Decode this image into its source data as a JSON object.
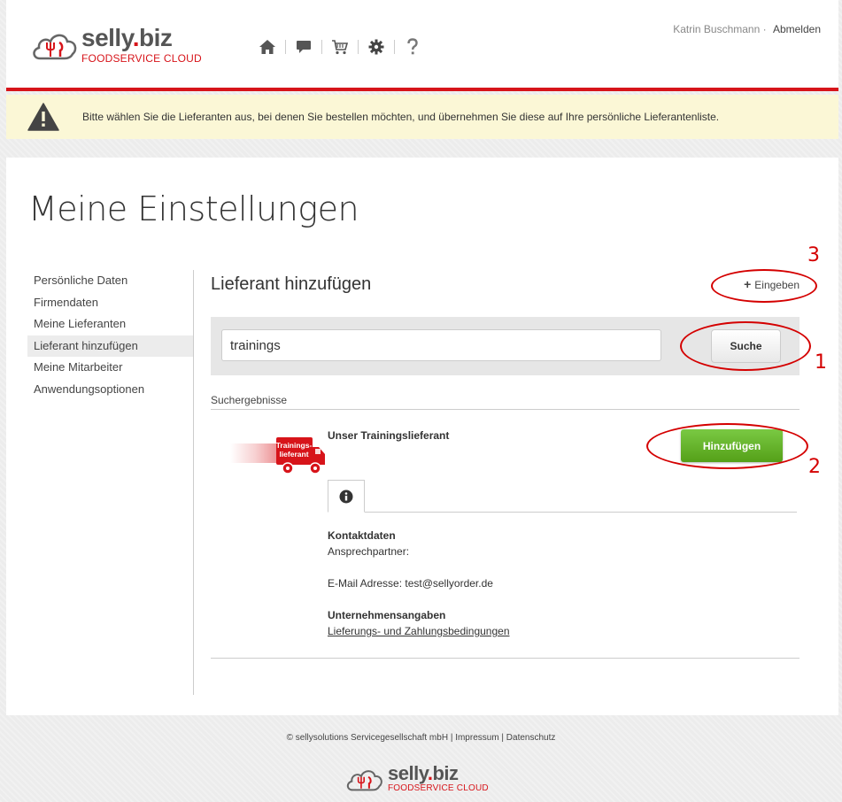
{
  "brand": {
    "word": "selly",
    "dot": ".",
    "tld": "biz",
    "tagline": "FOODSERVICE CLOUD",
    "accent": "#d7141a"
  },
  "topnav": {
    "icons": [
      "home-icon",
      "chat-icon",
      "cart-icon",
      "gear-icon",
      "help-icon"
    ]
  },
  "user": {
    "name": "Katrin Buschmann",
    "separator": "·",
    "logout_label": "Abmelden"
  },
  "notice": {
    "icon": "warning-icon",
    "text": "Bitte wählen Sie die Lieferanten aus, bei denen Sie bestellen möchten, und übernehmen Sie diese auf Ihre persönliche Lieferantenliste.",
    "bg": "#fbf7d6"
  },
  "page": {
    "title": "Meine Einstellungen"
  },
  "sidebar": {
    "items": [
      {
        "label": "Persönliche Daten",
        "active": false
      },
      {
        "label": "Firmendaten",
        "active": false
      },
      {
        "label": "Meine Lieferanten",
        "active": false
      },
      {
        "label": "Lieferant hinzufügen",
        "active": true
      },
      {
        "label": "Meine Mitarbeiter",
        "active": false
      },
      {
        "label": "Anwendungsoptionen",
        "active": false
      }
    ]
  },
  "section": {
    "title": "Lieferant hinzufügen",
    "add_link_icon": "+",
    "add_link_label": "Eingeben"
  },
  "search": {
    "value": "trainings",
    "button_label": "Suche"
  },
  "results": {
    "label": "Suchergebnisse",
    "supplier": {
      "name": "Unser Trainingslieferant",
      "badge_text": "Trainings-lieferant",
      "add_button_label": "Hinzufügen",
      "add_button_color": "#6ab42e",
      "tab_icon": "info-icon",
      "contact_heading": "Kontaktdaten",
      "contact_person": "Ansprechpartner:",
      "email_line": "E-Mail Adresse: test@sellyorder.de",
      "company_heading": "Unternehmensangaben",
      "terms_link": "Lieferungs- und Zahlungsbedingungen"
    }
  },
  "annotations": {
    "color": "#d40000",
    "labels": [
      "1",
      "2",
      "3"
    ]
  },
  "footer": {
    "text": "© sellysolutions Servicegesellschaft mbH | Impressum | Datenschutz"
  }
}
